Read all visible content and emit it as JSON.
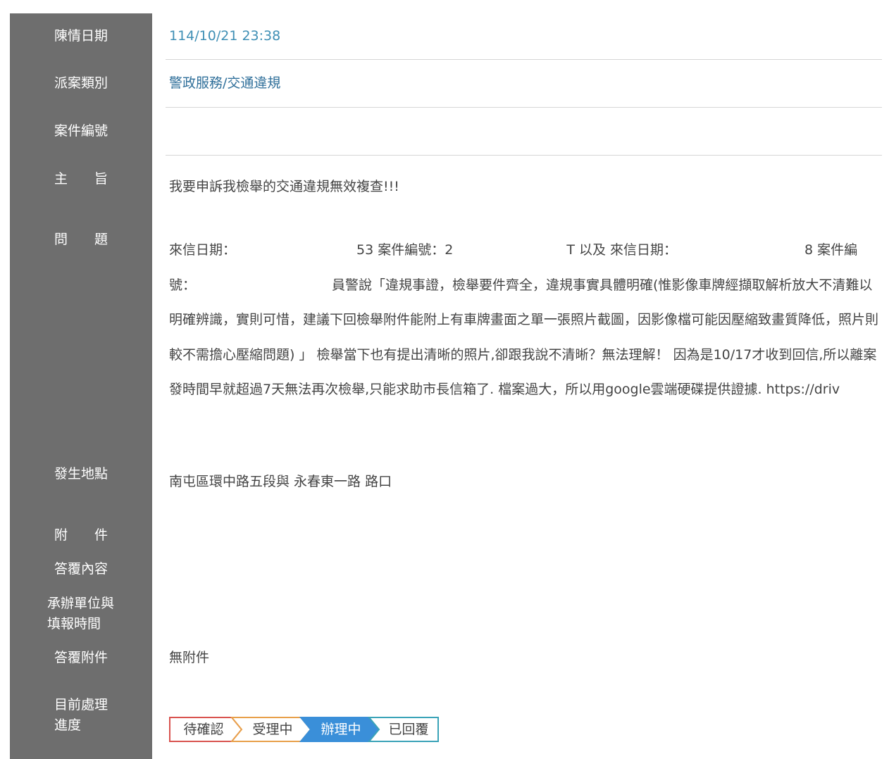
{
  "labels": {
    "date": "陳情日期",
    "category": "派案類別",
    "case_number": "案件編號",
    "subject": "主　　旨",
    "problem": "問　　題",
    "location": "發生地點",
    "attachment": "附　　件",
    "reply": "答覆內容",
    "unit_line1": "承辦單位與",
    "unit_line2": "填報時間",
    "reply_attachment": "答覆附件",
    "progress_line1": "目前處理",
    "progress_line2": "進度"
  },
  "values": {
    "date": "114/10/21 23:38",
    "category": "警政服務/交通違規",
    "case_number": "",
    "subject": "我要申訴我檢舉的交通違規無效複查!!!",
    "problem": {
      "p1": "來信日期：",
      "p2": "53 案件編號：2",
      "p3": "T 以及 來信日期：",
      "p4": "8 案件編號：",
      "p5": "員警說「違規事證，檢舉要件齊全，違規事實具體明確(惟影像車牌經擷取解析放大不清難以明確辨識，實則可惜，建議下回檢舉附件能附上有車牌畫面之單一張照片截圖，因影像檔可能因壓縮致畫質降低，照片則較不需擔心壓縮問題) 」 檢舉當下也有提出清晰的照片,卻跟我說不清晰？無法理解！ 因為是10/17才收到回信,所以離案發時間早就超過7天無法再次檢舉,只能求助市長信箱了. 檔案過大，所以用google雲端硬碟提供證據. https://driv"
    },
    "location": "南屯區環中路五段與 永春東一路 路口",
    "reply_attachment": "無附件"
  },
  "progress": {
    "steps": [
      "待確認",
      "受理中",
      "辦理中",
      "已回覆"
    ],
    "current_index": 2,
    "colors": {
      "step1": "#d9534f",
      "step2": "#e8a04a",
      "step3": "#3a8fd9",
      "step4": "#3aa3b8",
      "active_fill": "#3a8fd9"
    }
  }
}
